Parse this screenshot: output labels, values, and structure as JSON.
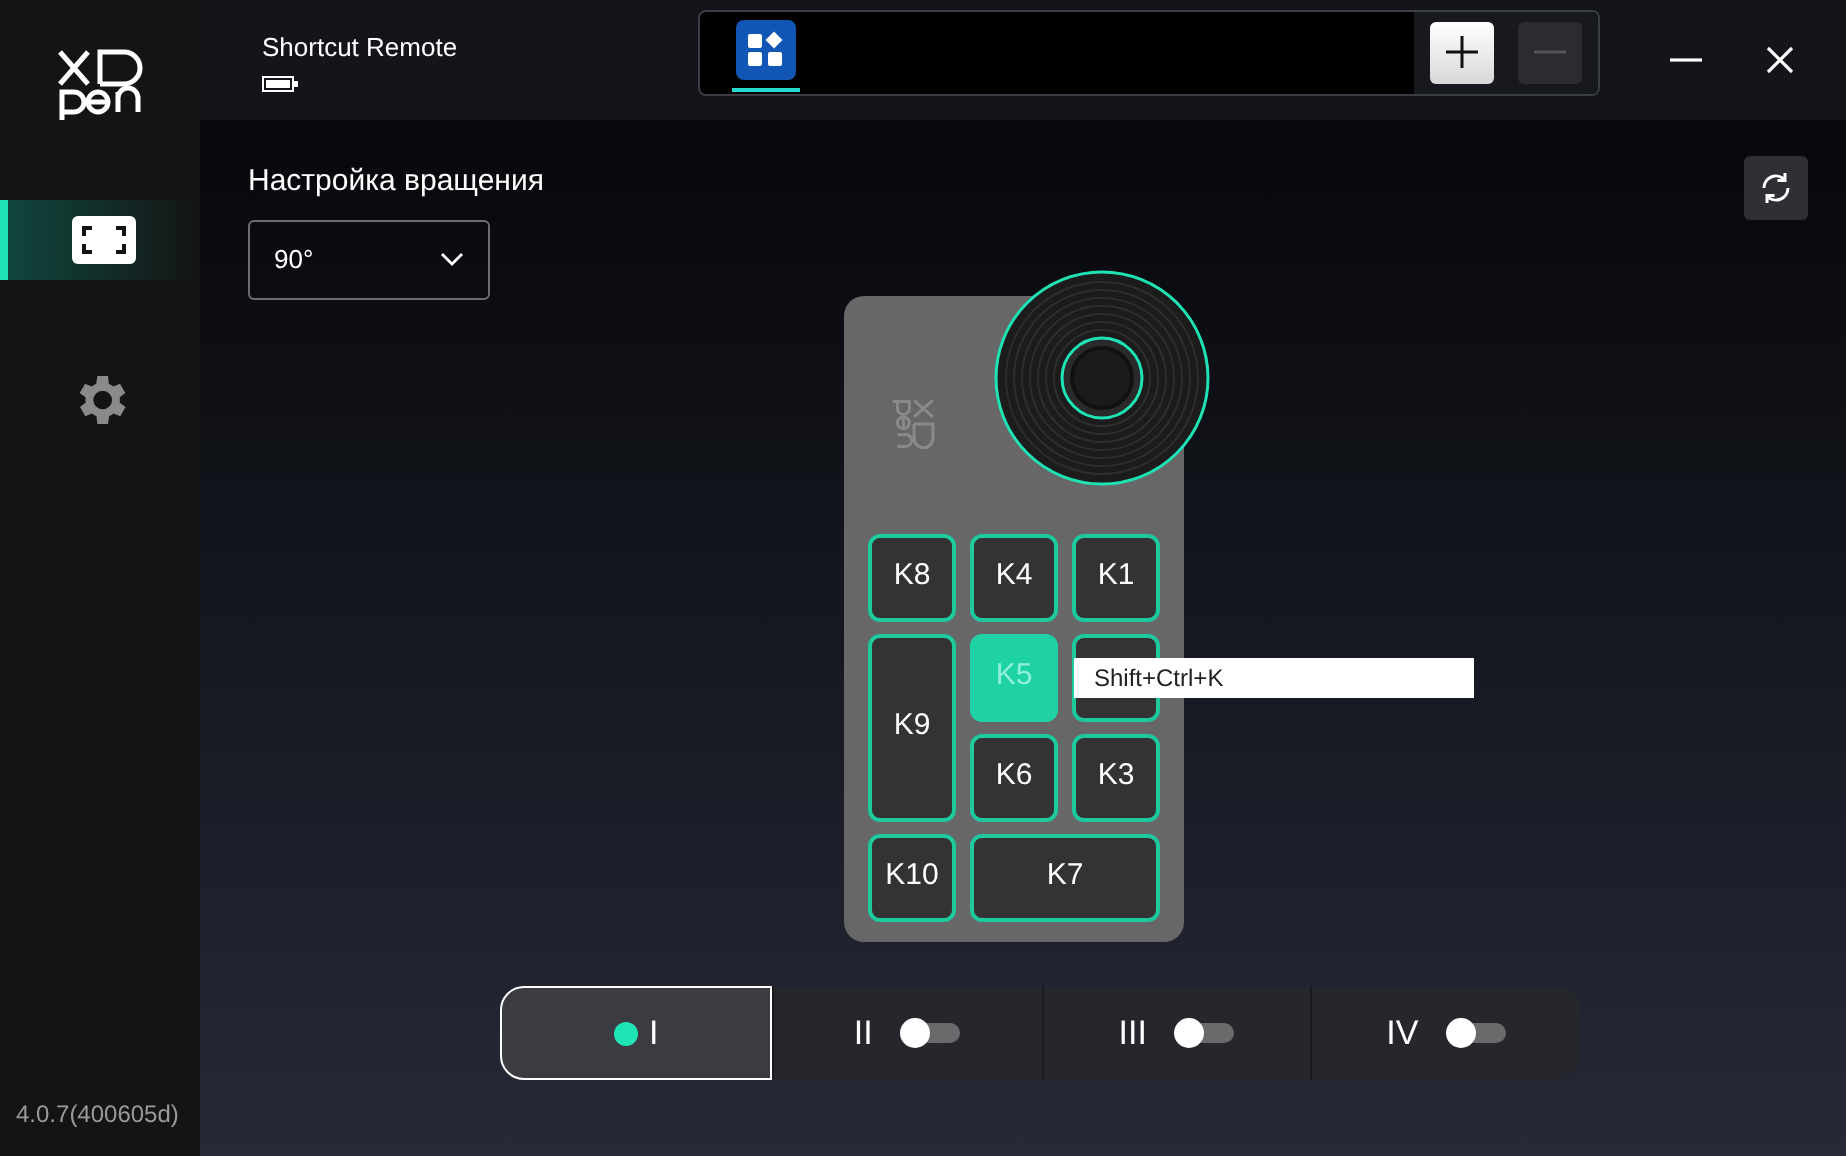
{
  "header": {
    "device_name": "Shortcut Remote",
    "device_tabs": [
      {
        "selected": true
      }
    ]
  },
  "sidebar": {
    "items": [
      {
        "kind": "device",
        "selected": true
      },
      {
        "kind": "settings",
        "selected": false
      }
    ],
    "version": "4.0.7(400605d)"
  },
  "rotation": {
    "label": "Настройка вращения",
    "value": "90°"
  },
  "keys": [
    {
      "label": "K8",
      "selected": false
    },
    {
      "label": "K4",
      "selected": false
    },
    {
      "label": "K1",
      "selected": false
    },
    {
      "label": "K9",
      "selected": false
    },
    {
      "label": "K5",
      "selected": true
    },
    {
      "selected": false
    },
    {
      "label": "K6",
      "selected": false
    },
    {
      "label": "K3",
      "selected": false
    },
    {
      "label": "K10",
      "selected": false
    },
    {
      "label": "K7",
      "selected": false
    }
  ],
  "tooltip": "Shift+Ctrl+K",
  "profiles": [
    {
      "label": "I",
      "selected": true,
      "kind": "dot"
    },
    {
      "label": "II",
      "selected": false,
      "kind": "toggle",
      "on": false
    },
    {
      "label": "III",
      "selected": false,
      "kind": "toggle",
      "on": false
    },
    {
      "label": "IV",
      "selected": false,
      "kind": "toggle",
      "on": false
    }
  ]
}
